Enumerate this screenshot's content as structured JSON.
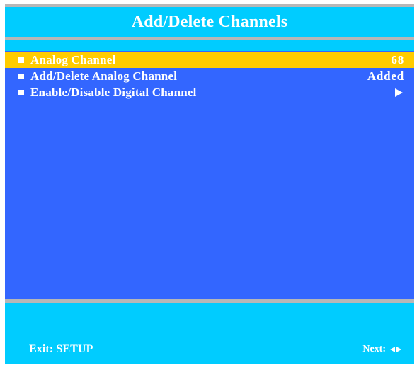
{
  "menu": {
    "title": "Add/Delete Channels",
    "items": [
      {
        "label": "Analog Channel",
        "value": "68",
        "selected": true
      },
      {
        "label": "Add/Delete Analog Channel",
        "value": "Added",
        "selected": false
      },
      {
        "label": "Enable/Disable Digital Channel",
        "value": "",
        "icon": "arrow-right-icon",
        "selected": false
      }
    ]
  },
  "footer": {
    "exit": "Exit: SETUP",
    "next": "Next:"
  },
  "colors": {
    "panel": "#3366ff",
    "header": "#00ccff",
    "selected": "#ffcc00",
    "divider": "#b7b7b7"
  }
}
